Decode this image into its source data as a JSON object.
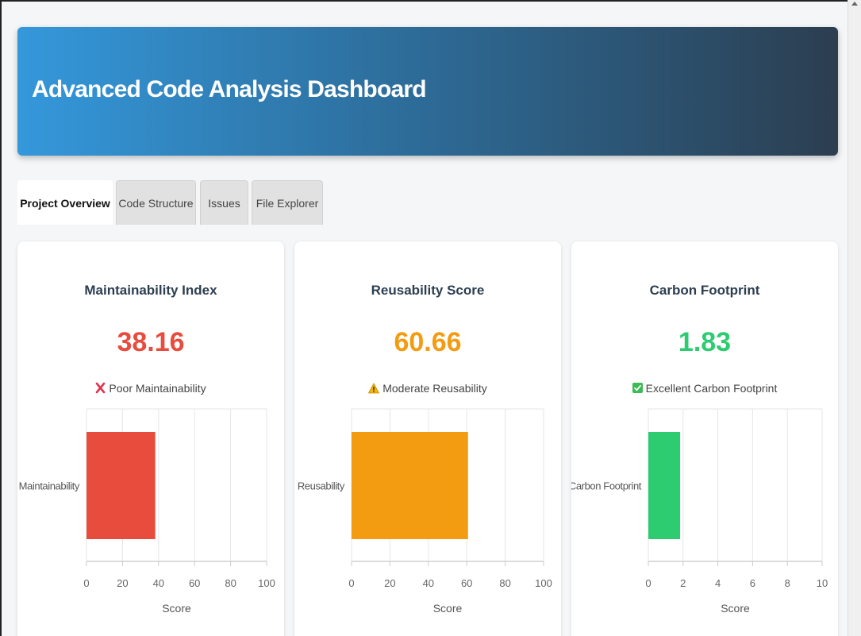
{
  "header": {
    "title": "Advanced Code Analysis Dashboard"
  },
  "tabs": [
    {
      "label": "Project Overview",
      "active": true
    },
    {
      "label": "Code Structure",
      "active": false
    },
    {
      "label": "Issues",
      "active": false
    },
    {
      "label": "File Explorer",
      "active": false
    }
  ],
  "cards": [
    {
      "title": "Maintainability Index",
      "value": "38.16",
      "value_color": "#e74c3c",
      "status": "Poor Maintainability",
      "status_icon": "cross-icon"
    },
    {
      "title": "Reusability Score",
      "value": "60.66",
      "value_color": "#f39c12",
      "status": "Moderate Reusability",
      "status_icon": "warning-icon"
    },
    {
      "title": "Carbon Footprint",
      "value": "1.83",
      "value_color": "#2ecc71",
      "status": "Excellent Carbon Footprint",
      "status_icon": "check-icon"
    }
  ],
  "chart_data": [
    {
      "type": "bar",
      "orientation": "horizontal",
      "categories": [
        "Maintainability"
      ],
      "values": [
        38.16
      ],
      "xlabel": "Score",
      "xlim": [
        0,
        100
      ],
      "xticks": [
        "0",
        "20",
        "40",
        "60",
        "80",
        "100"
      ],
      "bar_color": "#e74c3c",
      "grid": true
    },
    {
      "type": "bar",
      "orientation": "horizontal",
      "categories": [
        "Reusability"
      ],
      "values": [
        60.66
      ],
      "xlabel": "Score",
      "xlim": [
        0,
        100
      ],
      "xticks": [
        "0",
        "20",
        "40",
        "60",
        "80",
        "100"
      ],
      "bar_color": "#f39c12",
      "grid": true
    },
    {
      "type": "bar",
      "orientation": "horizontal",
      "categories": [
        "Carbon Footprint"
      ],
      "values": [
        1.83
      ],
      "xlabel": "Score",
      "xlim": [
        0,
        10
      ],
      "xticks": [
        "0",
        "2",
        "4",
        "6",
        "8",
        "10"
      ],
      "bar_color": "#2ecc71",
      "grid": true
    }
  ]
}
